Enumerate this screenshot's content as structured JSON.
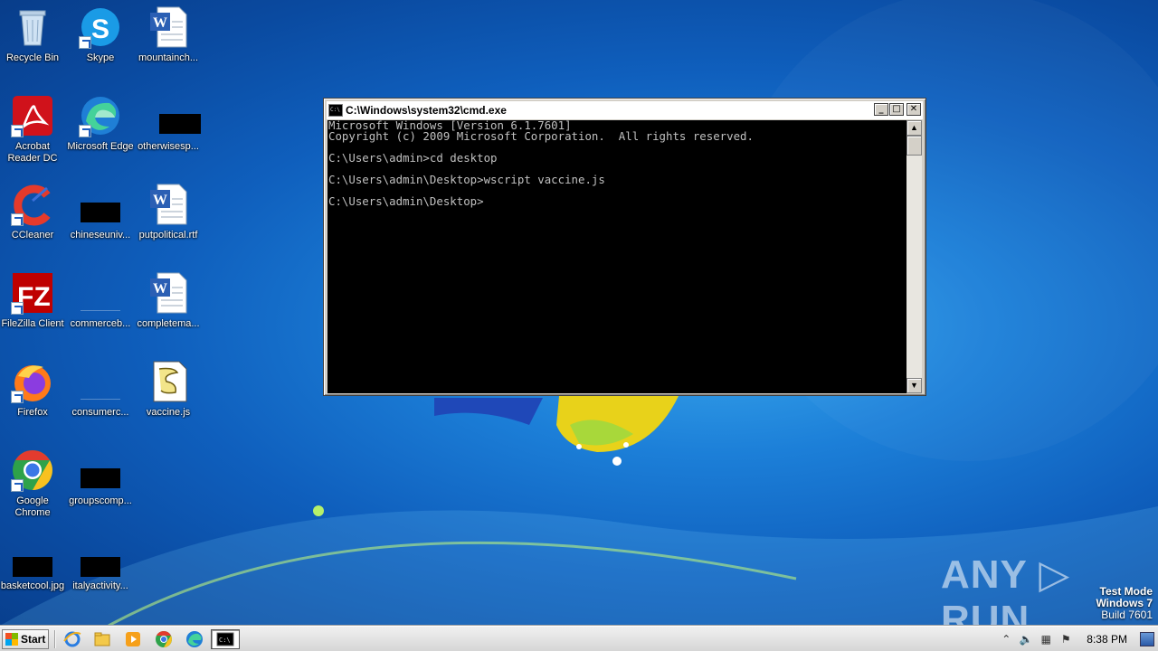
{
  "desktop": {
    "icons": [
      {
        "label": "Recycle Bin",
        "icon": "recycle-bin-icon"
      },
      {
        "label": "Skype",
        "icon": "skype-icon"
      },
      {
        "label": "mountainch...",
        "icon": "word-document-icon"
      },
      {
        "label": "Acrobat\nReader DC",
        "icon": "acrobat-icon"
      },
      {
        "label": "Microsoft Edge",
        "icon": "edge-icon"
      },
      {
        "label": "otherwisesp...",
        "icon": "redacted-icon"
      },
      {
        "label": "CCleaner",
        "icon": "ccleaner-icon"
      },
      {
        "label": "chineseuniv...",
        "icon": "redacted-icon"
      },
      {
        "label": "putpolitical.rtf",
        "icon": "word-document-icon"
      },
      {
        "label": "FileZilla Client",
        "icon": "filezilla-icon"
      },
      {
        "label": "commerceb...",
        "icon": "blank-file-icon"
      },
      {
        "label": "completema...",
        "icon": "word-document-icon"
      },
      {
        "label": "Firefox",
        "icon": "firefox-icon"
      },
      {
        "label": "consumerc...",
        "icon": "blank-file-icon"
      },
      {
        "label": "vaccine.js",
        "icon": "script-file-icon"
      },
      {
        "label": "Google\nChrome",
        "icon": "chrome-icon"
      },
      {
        "label": "groupscomp...",
        "icon": "redacted-icon"
      },
      {
        "label": "basketcool.jpg",
        "icon": "redacted-icon"
      },
      {
        "label": "italyactivity...",
        "icon": "redacted-icon"
      }
    ]
  },
  "cmd": {
    "title": "C:\\Windows\\system32\\cmd.exe",
    "lines": [
      "Microsoft Windows [Version 6.1.7601]",
      "Copyright (c) 2009 Microsoft Corporation.  All rights reserved.",
      "",
      "C:\\Users\\admin>cd desktop",
      "",
      "C:\\Users\\admin\\Desktop>wscript vaccine.js",
      "",
      "C:\\Users\\admin\\Desktop>"
    ],
    "minimize": "_",
    "maximize": "□",
    "close": "✕"
  },
  "watermark": {
    "brand": "ANY ▷ RUN",
    "mode": "Test Mode",
    "os": "Windows 7",
    "build": "Build 7601"
  },
  "taskbar": {
    "start_label": "Start",
    "clock": "8:38 PM",
    "pinned": [
      "internet-explorer-icon",
      "file-explorer-icon",
      "media-player-icon",
      "chrome-icon",
      "edge-icon"
    ],
    "active": "cmd-icon"
  }
}
